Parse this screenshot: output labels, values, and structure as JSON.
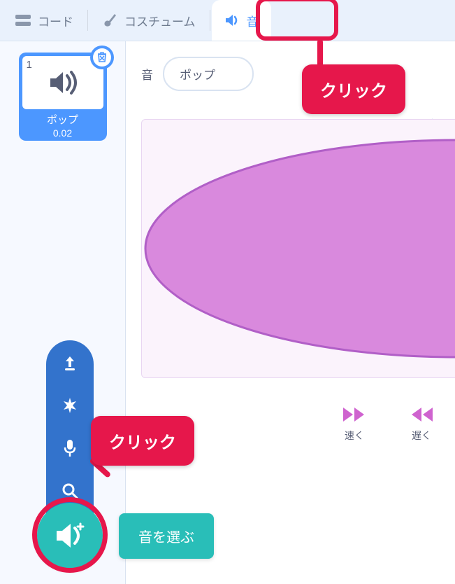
{
  "tabs": {
    "code": "コード",
    "costumes": "コスチューム",
    "sounds": "音"
  },
  "thumbnail": {
    "number": "1",
    "name": "ポップ",
    "duration": "0.02"
  },
  "editor": {
    "name_label": "音",
    "name_value": "ポップ",
    "faster": "速く",
    "slower": "遅く"
  },
  "choose_sound_label": "音を選ぶ",
  "callouts": {
    "top": "クリック",
    "bottom": "クリック"
  }
}
